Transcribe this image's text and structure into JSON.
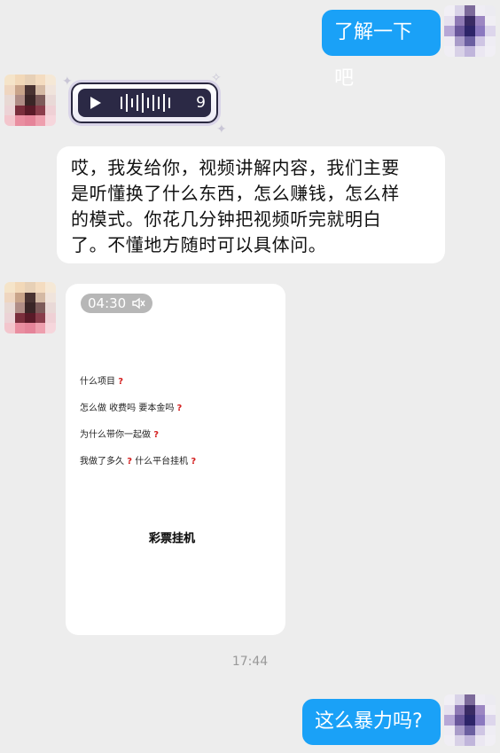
{
  "messages": {
    "m1": {
      "text": "了解一下吧"
    },
    "voice": {
      "duration": "9"
    },
    "m3": {
      "lines": [
        "哎，我发给你，视频讲解内容，我们主要",
        "是听懂换了什么东西，怎么赚钱，怎么样",
        "的模式。你花几分钟把视频听完就明白",
        "了。不懂地方随时可以具体问。"
      ]
    },
    "video": {
      "time": "04:30",
      "lines": [
        "什么项目",
        "怎么做 收费吗 要本金吗",
        "为什么带你一起做",
        "我做了多久",
        "什么平台挂机"
      ],
      "title": "彩票挂机"
    },
    "timestamp": "17:44",
    "m4": {
      "text": "这么暴力吗?"
    }
  },
  "colors": {
    "bubble_blue": "#1aa1f7",
    "background": "#ededed"
  },
  "icons": [
    "play-icon",
    "sound-wave-icon",
    "mute-icon",
    "question-mark-icon"
  ]
}
